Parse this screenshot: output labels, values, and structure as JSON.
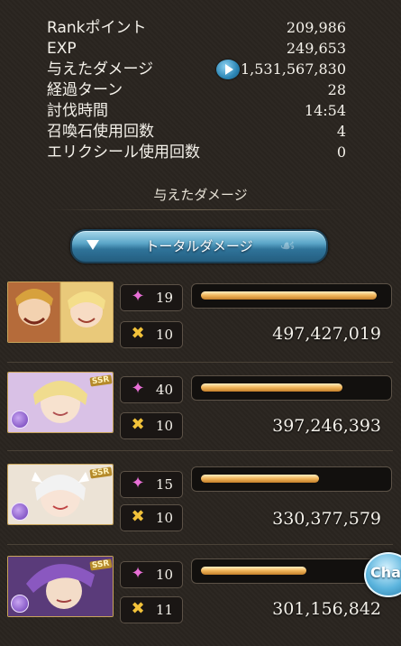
{
  "stats": [
    {
      "label": "Rankポイント",
      "value": "209,986"
    },
    {
      "label": "EXP",
      "value": "249,653"
    },
    {
      "label": "与えたダメージ",
      "value": "1,531,567,830"
    },
    {
      "label": "経過ターン",
      "value": "28"
    },
    {
      "label": "討伐時間",
      "value": "14:54"
    },
    {
      "label": "召喚石使用回数",
      "value": "4"
    },
    {
      "label": "エリクシール使用回数",
      "value": "0"
    }
  ],
  "section_title": "与えたダメージ",
  "total_button": {
    "label": "トータルダメージ"
  },
  "members": [
    {
      "skill_count": "19",
      "hit_count": "10",
      "damage": "497,427,019",
      "bar_fill": 0.97,
      "ssr": ""
    },
    {
      "skill_count": "40",
      "hit_count": "10",
      "damage": "397,246,393",
      "bar_fill": 0.78,
      "ssr": "SSR"
    },
    {
      "skill_count": "15",
      "hit_count": "10",
      "damage": "330,377,579",
      "bar_fill": 0.65,
      "ssr": "SSR"
    },
    {
      "skill_count": "10",
      "hit_count": "11",
      "damage": "301,156,842",
      "bar_fill": 0.58,
      "ssr": "SSR"
    }
  ],
  "icons": {
    "skill": "sparkle-icon",
    "hit": "cross-swords-icon",
    "element": "dark-element-icon",
    "play": "play-icon"
  },
  "colors": {
    "accent": "#5ba6c8",
    "bar": "#f0b55a",
    "background": "#2a2520"
  },
  "chat": {
    "label": "Chat"
  }
}
